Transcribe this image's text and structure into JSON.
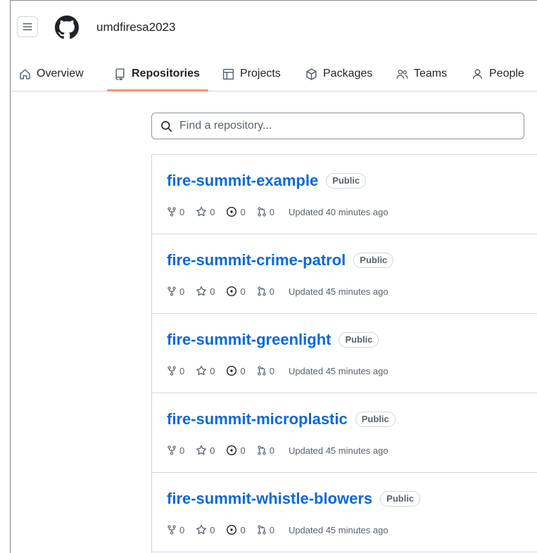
{
  "header": {
    "org_name": "umdfiresa2023",
    "menu_icon": "hamburger-icon",
    "logo_icon": "github-logo-icon"
  },
  "tabs": [
    {
      "label": "Overview",
      "icon": "home-icon",
      "active": false
    },
    {
      "label": "Repositories",
      "icon": "repo-icon",
      "active": true
    },
    {
      "label": "Projects",
      "icon": "table-icon",
      "active": false
    },
    {
      "label": "Packages",
      "icon": "package-icon",
      "active": false
    },
    {
      "label": "Teams",
      "icon": "people-icon",
      "active": false
    },
    {
      "label": "People",
      "icon": "person-icon",
      "active": false
    }
  ],
  "search": {
    "placeholder": "Find a repository...",
    "value": ""
  },
  "colors": {
    "accent_link": "#0969da",
    "tab_underline": "#fd8c73",
    "muted_text": "#59636e",
    "border": "#d0d7de"
  },
  "repositories": [
    {
      "name": "fire-summit-example",
      "visibility": "Public",
      "forks": "0",
      "stars": "0",
      "issues": "0",
      "pulls": "0",
      "updated": "Updated 40 minutes ago"
    },
    {
      "name": "fire-summit-crime-patrol",
      "visibility": "Public",
      "forks": "0",
      "stars": "0",
      "issues": "0",
      "pulls": "0",
      "updated": "Updated 45 minutes ago"
    },
    {
      "name": "fire-summit-greenlight",
      "visibility": "Public",
      "forks": "0",
      "stars": "0",
      "issues": "0",
      "pulls": "0",
      "updated": "Updated 45 minutes ago"
    },
    {
      "name": "fire-summit-microplastic",
      "visibility": "Public",
      "forks": "0",
      "stars": "0",
      "issues": "0",
      "pulls": "0",
      "updated": "Updated 45 minutes ago"
    },
    {
      "name": "fire-summit-whistle-blowers",
      "visibility": "Public",
      "forks": "0",
      "stars": "0",
      "issues": "0",
      "pulls": "0",
      "updated": "Updated 45 minutes ago"
    }
  ]
}
